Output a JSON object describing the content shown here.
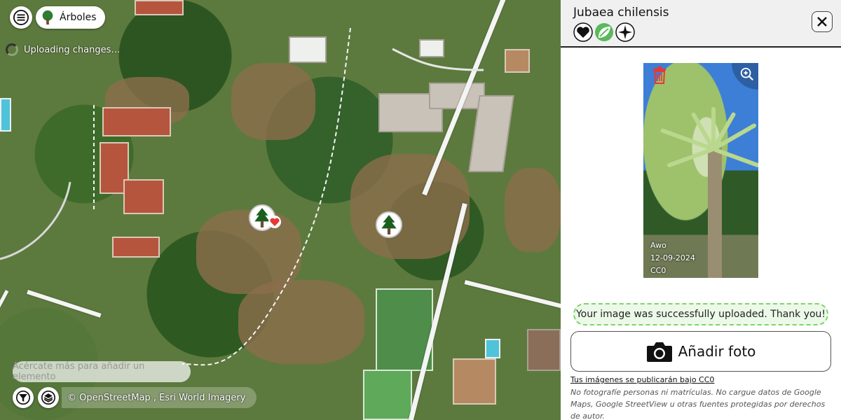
{
  "map": {
    "layer_label": "Árboles",
    "upload_status": "Uploading changes…",
    "zoom_hint": "Acércate más para añadir un elemento",
    "attribution": "© OpenStreetMap , Esri World Imagery",
    "icons": {
      "menu": "hamburger-menu-icon",
      "layer": "tree-icon",
      "filter": "filter-icon",
      "layers": "layers-icon",
      "marker": "tree-icon",
      "favorite": "heart-icon"
    }
  },
  "panel": {
    "title": "Jubaea chilensis",
    "feature_icons": [
      "heart-icon",
      "leaf-icon",
      "compass-icon"
    ],
    "photo": {
      "author": "Awo",
      "date": "12-09-2024",
      "license": "CC0",
      "icons": {
        "delete": "trash-icon",
        "zoom": "zoom-in-icon"
      }
    },
    "success_message": "Your image was successfully uploaded. Thank you!",
    "add_photo_label": "Añadir foto",
    "license_notice": "Tus imágenes se publicarán bajo CC0",
    "disclaimer": "No fotografíe personas ni matrículas. No cargue datos de Google Maps, Google StreetView u otras fuentes protegidas por derechos de autor.",
    "colors": {
      "success_border": "#7ed46b",
      "header_bg": "#f0f0f0"
    }
  }
}
